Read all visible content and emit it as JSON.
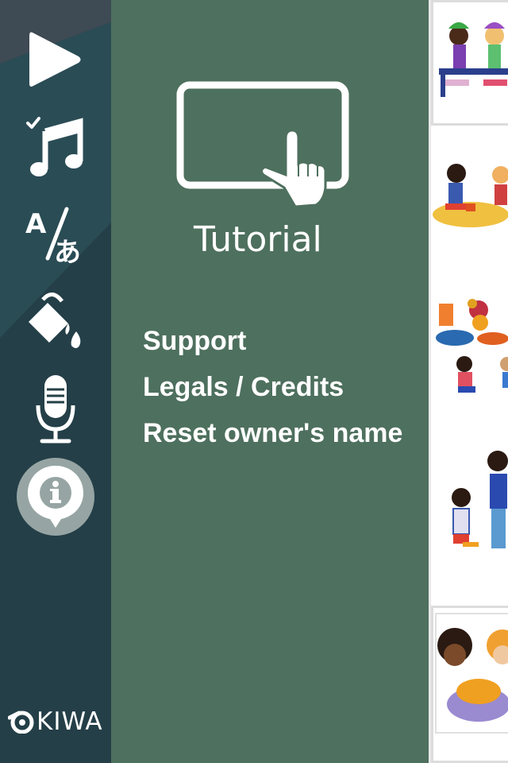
{
  "rail": {
    "items": [
      {
        "id": "play",
        "icon": "play-icon"
      },
      {
        "id": "music",
        "icon": "music-note-check-icon"
      },
      {
        "id": "language",
        "icon": "language-translate-icon"
      },
      {
        "id": "paint",
        "icon": "paint-bucket-icon"
      },
      {
        "id": "microphone",
        "icon": "microphone-icon"
      },
      {
        "id": "info",
        "icon": "info-icon",
        "selected": true
      }
    ],
    "brand": "KIWA"
  },
  "panel": {
    "tutorial_label": "Tutorial",
    "menu": [
      "Support",
      "Legals / Credits",
      "Reset owner's name"
    ]
  },
  "colors": {
    "rail": "#243f48",
    "panel": "#4e705e",
    "info_selected": "#96a5a3"
  },
  "thumbnails": [
    {
      "scene": "two-girls-on-bench"
    },
    {
      "scene": "children-playing-in-sand"
    },
    {
      "scene": "cat-and-flower-vase-with-children"
    },
    {
      "scene": "child-and-adult-talking"
    },
    {
      "scene": "girls-with-orange-cat"
    }
  ]
}
